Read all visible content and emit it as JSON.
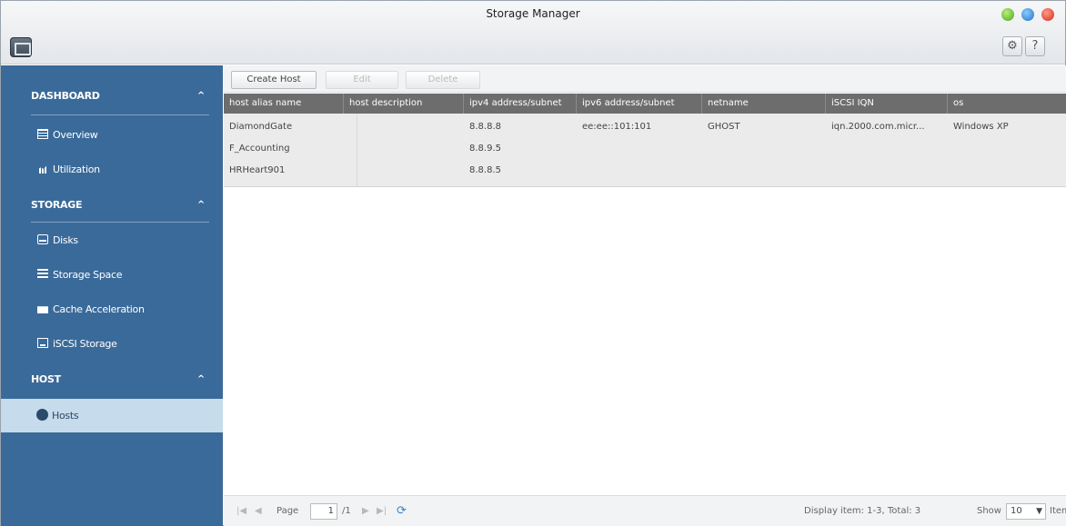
{
  "window": {
    "title": "Storage Manager"
  },
  "toolbar": {
    "settings_icon": "gear-icon",
    "help_label": "?"
  },
  "sidebar": {
    "sections": [
      {
        "label": "DASHBOARD",
        "items": [
          {
            "label": "Overview",
            "icon": "overview-icon"
          },
          {
            "label": "Utilization",
            "icon": "utilization-icon"
          }
        ]
      },
      {
        "label": "STORAGE",
        "items": [
          {
            "label": "Disks",
            "icon": "disk-icon"
          },
          {
            "label": "Storage Space",
            "icon": "storage-space-icon"
          },
          {
            "label": "Cache Acceleration",
            "icon": "cache-icon"
          },
          {
            "label": "iSCSI Storage",
            "icon": "iscsi-icon"
          }
        ]
      },
      {
        "label": "HOST",
        "items": [
          {
            "label": "Hosts",
            "icon": "hosts-icon",
            "active": true
          }
        ]
      }
    ],
    "chevron": "^"
  },
  "actions": {
    "create": "Create Host",
    "edit": "Edit",
    "delete": "Delete"
  },
  "table": {
    "headers": [
      "host alias name",
      "host description",
      "ipv4 address/subnet",
      "ipv6 address/subnet",
      "netname",
      "iSCSI IQN",
      "os"
    ],
    "rows": [
      [
        "DiamondGate",
        "",
        "8.8.8.8",
        "ee:ee::101:101",
        "GHOST",
        "iqn.2000.com.micr...",
        "Windows XP"
      ],
      [
        "F_Accounting",
        "",
        "8.8.9.5",
        "",
        "",
        "",
        ""
      ],
      [
        "HRHeart901",
        "",
        "8.8.8.5",
        "",
        "",
        "",
        ""
      ]
    ]
  },
  "pager": {
    "page_label": "Page",
    "page_value": "1",
    "page_total": "/1",
    "first": "|◀",
    "prev": "◀",
    "next": "▶",
    "last": "▶|",
    "display": "Display item: 1-3, Total: 3",
    "show_label": "Show",
    "show_value": "10",
    "items_label": "Items"
  }
}
